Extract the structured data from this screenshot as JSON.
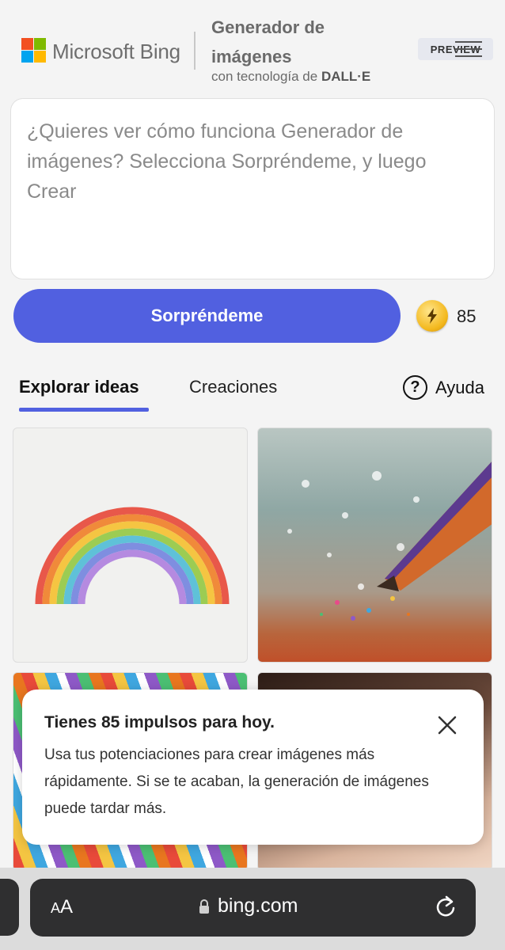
{
  "header": {
    "brand": "Microsoft Bing",
    "product_title": "Generador de imágenes",
    "product_sub_prefix": "con tecnología de ",
    "product_sub_strong": "DALL·E",
    "preview_badge": "PREVIEW",
    "logo_colors": [
      "#f25022",
      "#7fba00",
      "#00a4ef",
      "#ffb900"
    ]
  },
  "prompt": {
    "placeholder": "¿Quieres ver cómo funciona Generador de imágenes? Selecciona Sorpréndeme, y luego Crear"
  },
  "actions": {
    "surprise_label": "Sorpréndeme",
    "boost_count": "85",
    "accent_color": "#5160e0"
  },
  "tabs": {
    "explore": "Explorar ideas",
    "creations": "Creaciones",
    "help": "Ayuda",
    "help_icon": "?"
  },
  "gallery": {
    "items": [
      {
        "icon": "rainbow-paper-image"
      },
      {
        "icon": "glitter-pencil-image"
      },
      {
        "icon": "colorful-stripes-image"
      },
      {
        "icon": "face-closeup-image"
      }
    ]
  },
  "toast": {
    "title": "Tienes 85 impulsos para hoy.",
    "body": "Usa tus potenciaciones para crear imágenes más rápidamente. Si se te acaban, la generación de imágenes puede tardar más."
  },
  "browser": {
    "text_size_big": "A",
    "text_size_small": "A",
    "url": "bing.com"
  }
}
